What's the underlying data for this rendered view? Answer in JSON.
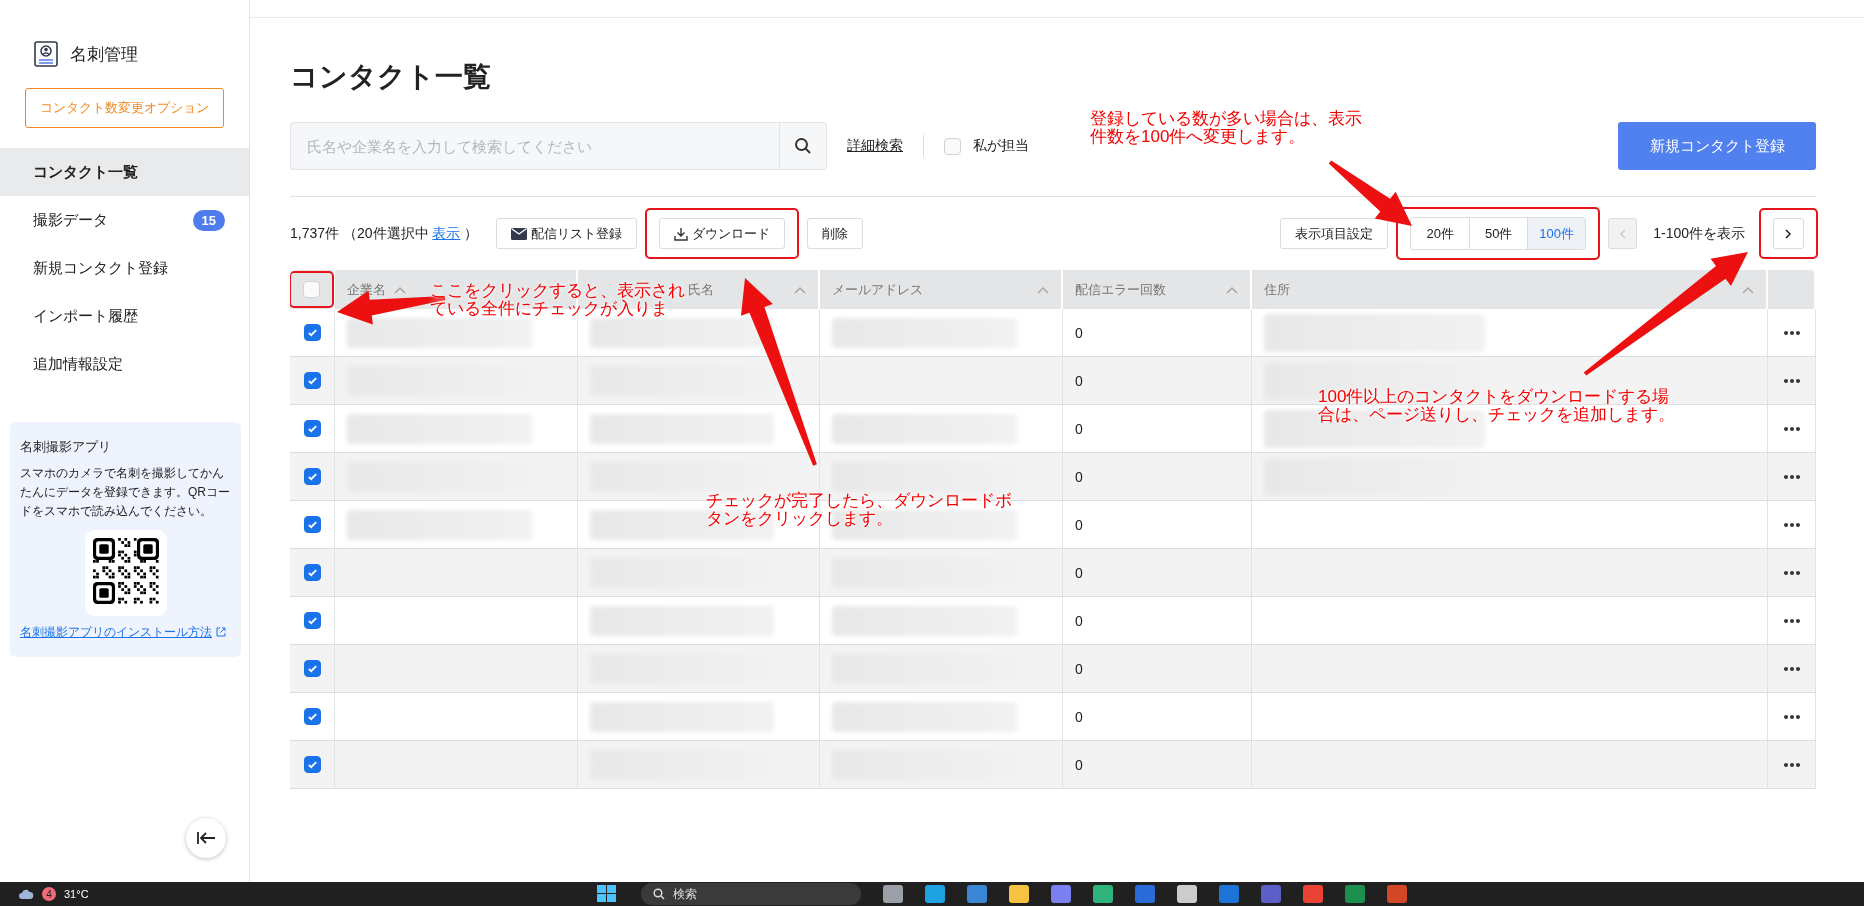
{
  "sidebar": {
    "app_title": "名刺管理",
    "option_button": "コンタクト数変更オプション",
    "items": [
      {
        "label": "コンタクト一覧",
        "selected": true
      },
      {
        "label": "撮影データ",
        "selected": false,
        "badge": "15"
      },
      {
        "label": "新規コンタクト登録",
        "selected": false
      },
      {
        "label": "インポート履歴",
        "selected": false
      },
      {
        "label": "追加情報設定",
        "selected": false
      }
    ],
    "app_card": {
      "title": "名刺撮影アプリ",
      "description": "スマホのカメラで名刺を撮影してかんたんにデータを登録できます。QRコードをスマホで読み込んでください。",
      "link": "名刺撮影アプリのインストール方法"
    }
  },
  "page": {
    "title": "コンタクト一覧",
    "search_placeholder": "氏名や企業名を入力して検索してください",
    "advanced_search": "詳細検索",
    "mine_filter": {
      "label": "私が担当",
      "checked": false
    },
    "new_button": "新規コンタクト登録"
  },
  "toolbar": {
    "count": "1,737件",
    "selection": "（20件選択中",
    "selection_link": "表示",
    "selection_end": "）",
    "actions": [
      {
        "label": "配信リスト登録",
        "kind": "mail",
        "highlighted": false
      },
      {
        "label": "ダウンロード",
        "kind": "download",
        "highlighted": true
      },
      {
        "label": "削除",
        "kind": "plain",
        "highlighted": false
      }
    ],
    "column_settings": "表示項目設定",
    "page_sizes": {
      "highlighted": true,
      "options": [
        {
          "label": "20件",
          "selected": false
        },
        {
          "label": "50件",
          "selected": false
        },
        {
          "label": "100件",
          "selected": true
        }
      ]
    },
    "pagination": {
      "range": "1-100件を表示",
      "prev_disabled": true,
      "next_highlighted": true
    }
  },
  "table": {
    "select_all": {
      "checked": false,
      "highlighted": true
    },
    "columns": [
      "企業名",
      "氏名",
      "メールアドレス",
      "配信エラー回数",
      "住所"
    ],
    "rows": [
      {
        "checked": true,
        "error_count": "0",
        "redacted": [
          true,
          true,
          true,
          true
        ]
      },
      {
        "checked": true,
        "error_count": "0",
        "redacted": [
          true,
          true,
          false,
          true
        ]
      },
      {
        "checked": true,
        "error_count": "0",
        "redacted": [
          true,
          true,
          true,
          true
        ]
      },
      {
        "checked": true,
        "error_count": "0",
        "redacted": [
          true,
          true,
          true,
          true
        ]
      },
      {
        "checked": true,
        "error_count": "0",
        "redacted": [
          true,
          true,
          true,
          false
        ]
      },
      {
        "checked": true,
        "error_count": "0",
        "redacted": [
          false,
          true,
          true,
          false
        ]
      },
      {
        "checked": true,
        "error_count": "0",
        "redacted": [
          false,
          true,
          true,
          false
        ]
      },
      {
        "checked": true,
        "error_count": "0",
        "redacted": [
          false,
          true,
          true,
          false
        ]
      },
      {
        "checked": true,
        "error_count": "0",
        "redacted": [
          false,
          true,
          true,
          false
        ]
      },
      {
        "checked": true,
        "error_count": "0",
        "redacted": [
          false,
          true,
          true,
          false
        ]
      }
    ]
  },
  "callouts": [
    {
      "lines": [
        "ここをクリックすると、表示され",
        "ている全件にチェックが入りま"
      ]
    },
    {
      "lines": [
        "登録している数が多い場合は、表示",
        "件数を100件へ変更します。"
      ]
    },
    {
      "lines": [
        "チェックが完了したら、ダウンロードボ",
        "タンをクリックします。"
      ]
    },
    {
      "lines": [
        "100件以上のコンタクトをダウンロードする場",
        "合は、ページ送りし、チェックを追加します。"
      ]
    }
  ],
  "taskbar": {
    "weather_badge": "4",
    "temperature": "31°C",
    "search": "検索"
  }
}
